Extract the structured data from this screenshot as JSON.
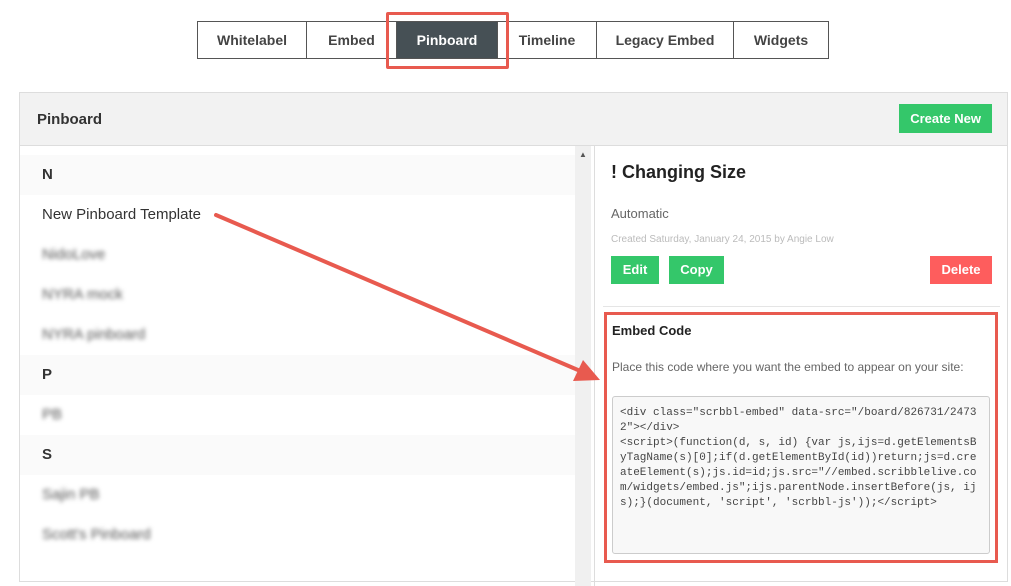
{
  "tabs": [
    {
      "label": "Whitelabel"
    },
    {
      "label": "Embed"
    },
    {
      "label": "Pinboard"
    },
    {
      "label": "Timeline"
    },
    {
      "label": "Legacy Embed"
    },
    {
      "label": "Widgets"
    }
  ],
  "panel": {
    "title": "Pinboard",
    "create_label": "Create New"
  },
  "list": [
    {
      "type": "header",
      "label": "N"
    },
    {
      "type": "item",
      "label": "New Pinboard Template"
    },
    {
      "type": "blur",
      "label": "NidoLove"
    },
    {
      "type": "blur",
      "label": "NYRA mock"
    },
    {
      "type": "blur",
      "label": "NYRA pinboard"
    },
    {
      "type": "header",
      "label": "P"
    },
    {
      "type": "blur",
      "label": "PB"
    },
    {
      "type": "header",
      "label": "S"
    },
    {
      "type": "blur",
      "label": "Sajin PB"
    },
    {
      "type": "blur",
      "label": "Scott's Pinboard"
    }
  ],
  "detail": {
    "title": "! Changing Size",
    "mode": "Automatic",
    "created": "Created Saturday, January 24, 2015 by Angie Low",
    "edit": "Edit",
    "copy": "Copy",
    "delete": "Delete",
    "embed_heading": "Embed Code",
    "embed_desc": "Place this code where you want the embed to appear on your site:",
    "embed_code": "<div class=\"scrbbl-embed\" data-src=\"/board/826731/24732\"></div>\n<script>(function(d, s, id) {var js,ijs=d.getElementsByTagName(s)[0];if(d.getElementById(id))return;js=d.createElement(s);js.id=id;js.src=\"//embed.scribblelive.com/widgets/embed.js\";ijs.parentNode.insertBefore(js, ijs);}(document, 'script', 'scrbbl-js'));</script>"
  },
  "colors": {
    "green": "#34c76a",
    "red": "#fe5d5d",
    "annotation": "#e85a4f",
    "active_tab": "#465055"
  }
}
